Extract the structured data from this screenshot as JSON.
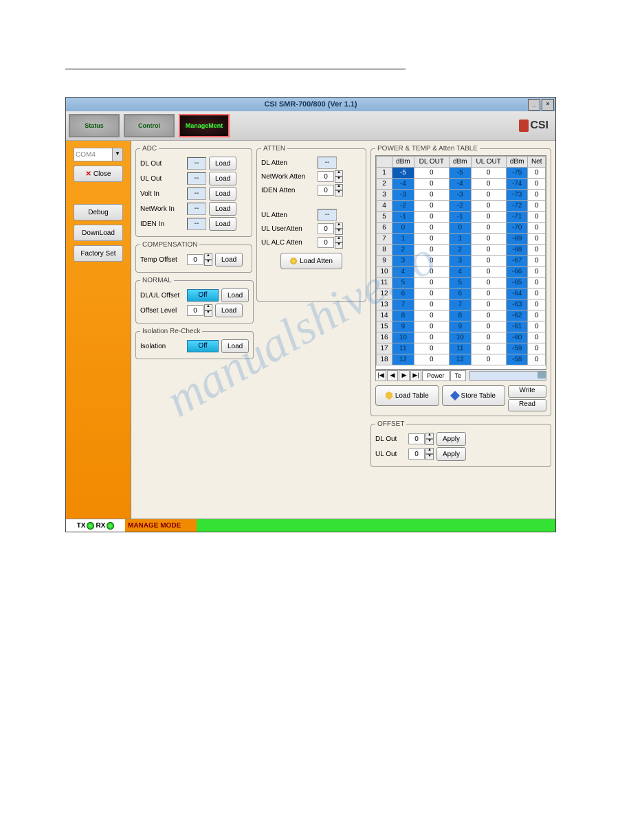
{
  "window": {
    "title": "CSI SMR-700/800 (Ver 1.1)",
    "logo_text": "CSI"
  },
  "tabs": {
    "status": "Status",
    "control": "Control",
    "manage": "ManageMent"
  },
  "sidebar": {
    "com_port": "COM4",
    "close": "Close",
    "debug": "Debug",
    "download": "DownLoad",
    "factory": "Factory Set"
  },
  "adc": {
    "legend": "ADC",
    "items": [
      {
        "label": "DL Out",
        "val": "--"
      },
      {
        "label": "UL Out",
        "val": "--"
      },
      {
        "label": "Volt In",
        "val": "--"
      },
      {
        "label": "NetWork In",
        "val": "--"
      },
      {
        "label": "IDEN In",
        "val": "--"
      }
    ],
    "load": "Load"
  },
  "comp": {
    "legend": "COMPENSATION",
    "temp_offset_label": "Temp Offset",
    "temp_offset_val": "0",
    "load": "Load"
  },
  "normal": {
    "legend": "NORMAL",
    "dlul_label": "DL/UL Offset",
    "dlul_toggle": "Off",
    "offset_level_label": "Offset Level",
    "offset_level_val": "0",
    "load": "Load"
  },
  "iso": {
    "legend": "Isolation Re-Check",
    "label": "Isolation",
    "toggle": "Off",
    "load": "Load"
  },
  "atten": {
    "legend": "ATTEN",
    "dl_atten_label": "DL Atten",
    "dl_atten_val": "--",
    "network_label": "NetWork Atten",
    "network_val": "0",
    "iden_label": "IDEN Atten",
    "iden_val": "0",
    "ul_atten_label": "UL Atten",
    "ul_atten_val": "--",
    "ul_user_label": "UL UserAtten",
    "ul_user_val": "0",
    "ul_alc_label": "UL ALC Atten",
    "ul_alc_val": "0",
    "load_atten": "Load  Atten"
  },
  "table": {
    "legend": "POWER & TEMP & Atten TABLE",
    "headers": [
      "",
      "dBm",
      "DL OUT",
      "dBm",
      "UL OUT",
      "dBm",
      "Net"
    ],
    "rows": [
      [
        "1",
        "-5",
        "0",
        "-5",
        "0",
        "-75",
        "0"
      ],
      [
        "2",
        "-4",
        "0",
        "-4",
        "0",
        "-74",
        "0"
      ],
      [
        "3",
        "-3",
        "0",
        "-3",
        "0",
        "-73",
        "0"
      ],
      [
        "4",
        "-2",
        "0",
        "-2",
        "0",
        "-72",
        "0"
      ],
      [
        "5",
        "-1",
        "0",
        "-1",
        "0",
        "-71",
        "0"
      ],
      [
        "6",
        "0",
        "0",
        "0",
        "0",
        "-70",
        "0"
      ],
      [
        "7",
        "1",
        "0",
        "1",
        "0",
        "-69",
        "0"
      ],
      [
        "8",
        "2",
        "0",
        "2",
        "0",
        "-68",
        "0"
      ],
      [
        "9",
        "3",
        "0",
        "3",
        "0",
        "-67",
        "0"
      ],
      [
        "10",
        "4",
        "0",
        "4",
        "0",
        "-66",
        "0"
      ],
      [
        "11",
        "5",
        "0",
        "5",
        "0",
        "-65",
        "0"
      ],
      [
        "12",
        "6",
        "0",
        "6",
        "0",
        "-64",
        "0"
      ],
      [
        "13",
        "7",
        "0",
        "7",
        "0",
        "-63",
        "0"
      ],
      [
        "14",
        "8",
        "0",
        "8",
        "0",
        "-62",
        "0"
      ],
      [
        "15",
        "9",
        "0",
        "9",
        "0",
        "-61",
        "0"
      ],
      [
        "16",
        "10",
        "0",
        "10",
        "0",
        "-60",
        "0"
      ],
      [
        "17",
        "11",
        "0",
        "11",
        "0",
        "-59",
        "0"
      ],
      [
        "18",
        "12",
        "0",
        "12",
        "0",
        "-58",
        "0"
      ]
    ],
    "nav_tab1": "Power",
    "nav_tab2": "Te",
    "load_table": "Load Table",
    "store_table": "Store Table",
    "write": "Write",
    "read": "Read"
  },
  "offset": {
    "legend": "OFFSET",
    "dl_label": "DL Out",
    "dl_val": "0",
    "ul_label": "UL Out",
    "ul_val": "0",
    "apply": "Apply"
  },
  "status": {
    "tx": "TX",
    "rx": "RX",
    "mode": "MANAGE MODE"
  },
  "watermark": "manualshive.co"
}
